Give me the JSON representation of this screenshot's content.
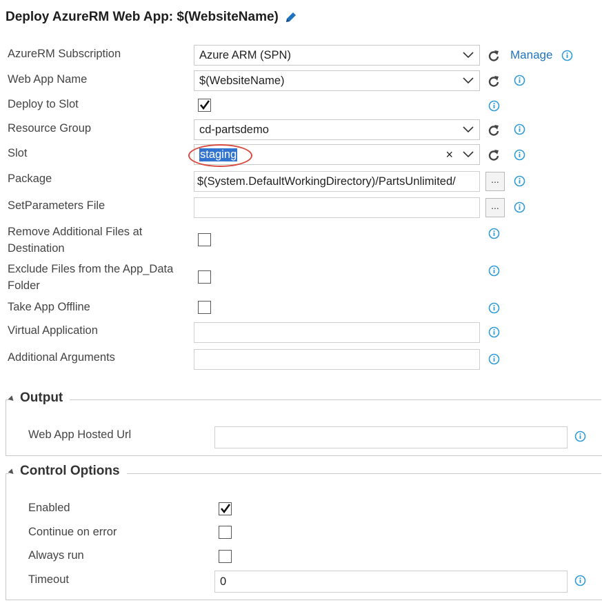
{
  "header": {
    "title": "Deploy AzureRM Web App: $(WebsiteName)",
    "edit_icon": "pencil-icon"
  },
  "fields": {
    "subscription": {
      "label": "AzureRM Subscription",
      "value": "Azure ARM (SPN)",
      "manage_label": "Manage"
    },
    "web_app_name": {
      "label": "Web App Name",
      "value": "$(WebsiteName)"
    },
    "deploy_to_slot": {
      "label": "Deploy to Slot",
      "checked": true
    },
    "resource_group": {
      "label": "Resource Group",
      "value": "cd-partsdemo"
    },
    "slot": {
      "label": "Slot",
      "value": "staging",
      "clear_label": "×"
    },
    "package": {
      "label": "Package",
      "value": "$(System.DefaultWorkingDirectory)/PartsUnlimited/",
      "browse_label": "..."
    },
    "setparameters": {
      "label": "SetParameters File",
      "value": "",
      "browse_label": "..."
    },
    "remove_additional": {
      "label": "Remove Additional Files at Destination",
      "checked": false
    },
    "exclude_app_data": {
      "label": "Exclude Files from the App_Data Folder",
      "checked": false
    },
    "take_offline": {
      "label": "Take App Offline",
      "checked": false
    },
    "virtual_app": {
      "label": "Virtual Application",
      "value": ""
    },
    "additional_args": {
      "label": "Additional Arguments",
      "value": ""
    }
  },
  "output": {
    "heading": "Output",
    "hosted_url": {
      "label": "Web App Hosted Url",
      "value": ""
    }
  },
  "control_options": {
    "heading": "Control Options",
    "enabled": {
      "label": "Enabled",
      "checked": true
    },
    "continue_on_error": {
      "label": "Continue on error",
      "checked": false
    },
    "always_run": {
      "label": "Always run",
      "checked": false
    },
    "timeout": {
      "label": "Timeout",
      "value": "0"
    }
  },
  "colors": {
    "accent": "#1e73be",
    "info": "#2f9bd8",
    "highlight_ring": "#d94a3f",
    "selection": "#3074d0"
  }
}
